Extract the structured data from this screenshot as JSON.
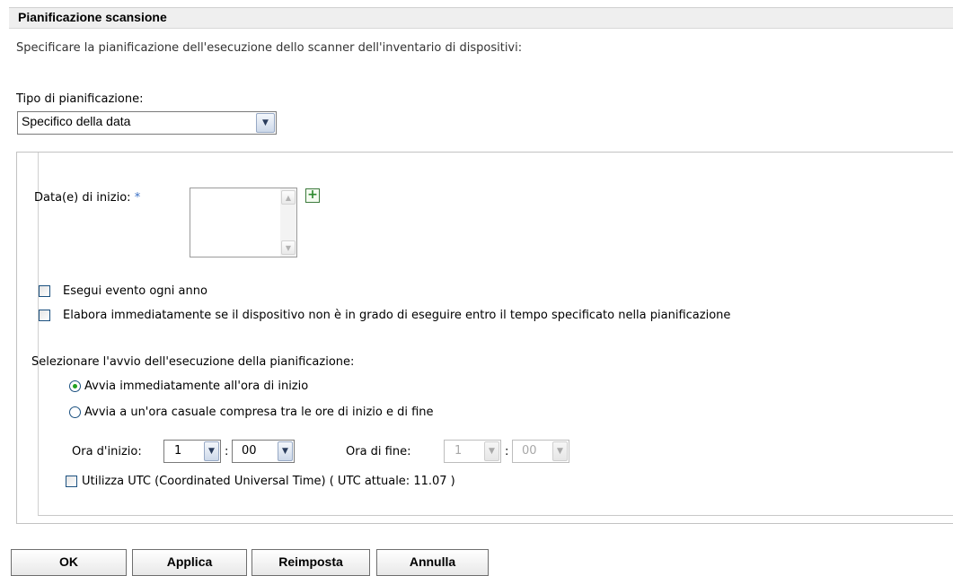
{
  "header": {
    "title": "Pianificazione scansione"
  },
  "description": "Specificare la pianificazione dell'esecuzione dello scanner dell'inventario di dispositivi:",
  "schedule_type": {
    "label": "Tipo di pianificazione:",
    "selected": "Specifico della data"
  },
  "start_dates": {
    "label": "Data(e) di inizio:",
    "required_marker": "*",
    "icons": {
      "add": "plus-icon",
      "scroll_up": "chevron-up-icon",
      "scroll_down": "chevron-down-icon"
    }
  },
  "options": {
    "yearly": "Esegui evento ogni anno",
    "process_immediately": "Elabora immediatamente se il dispositivo non è in grado di eseguire entro il tempo specificato nella pianificazione"
  },
  "run_start": {
    "label": "Selezionare l'avvio dell'esecuzione della pianificazione:",
    "radio_immediate": "Avvia immediatamente all'ora di inizio",
    "radio_random": "Avvia a un'ora casuale compresa tra le ore di inizio e di fine",
    "selected": "immediate"
  },
  "times": {
    "start_label": "Ora d'inizio:",
    "start_hour": "1",
    "start_minute": "00",
    "separator": ":",
    "end_label": "Ora di fine:",
    "end_hour": "1",
    "end_minute": "00"
  },
  "utc": {
    "label": "Utilizza UTC (Coordinated Universal Time) ( UTC attuale: 11.07 )"
  },
  "buttons": {
    "ok": "OK",
    "apply": "Applica",
    "reset": "Reimposta",
    "cancel": "Annulla"
  },
  "colors": {
    "radio_selected": "#21a121",
    "required": "#3a6fc4",
    "add_icon": "#2d8a2d"
  }
}
